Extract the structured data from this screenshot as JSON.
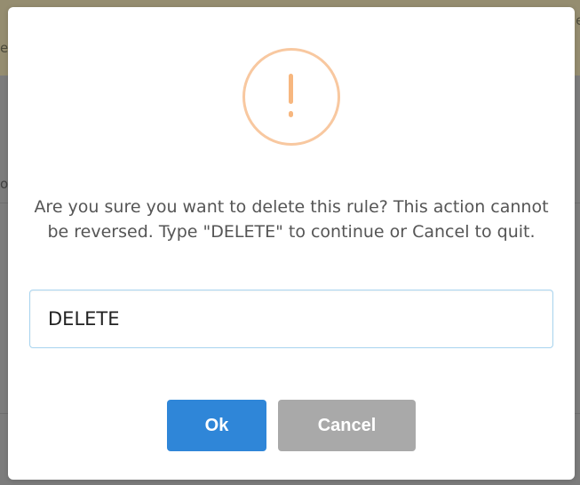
{
  "background": {
    "banner_text_right": "le",
    "banner_text_left": "er",
    "page_text_left": "o"
  },
  "dialog": {
    "icon": "exclamation-icon",
    "message": "Are you sure you want to delete this rule? This action cannot be reversed. Type \"DELETE\" to continue or Cancel to quit.",
    "input_value": "DELETE",
    "ok_label": "Ok",
    "cancel_label": "Cancel"
  },
  "colors": {
    "ok_button": "#2f86d8",
    "cancel_button": "#a9a9a9",
    "warning_icon": "#f8c8a0",
    "input_border": "#a8d4ef"
  }
}
